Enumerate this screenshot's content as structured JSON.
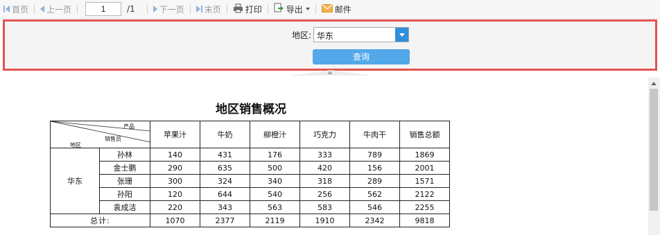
{
  "toolbar": {
    "first": "首页",
    "prev": "上一页",
    "page_value": "1",
    "page_total": "/1",
    "next": "下一页",
    "last": "末页",
    "print": "打印",
    "export": "导出",
    "mail": "邮件"
  },
  "params": {
    "region_label": "地区:",
    "region_value": "华东",
    "query_label": "查询"
  },
  "report": {
    "title": "地区销售概况",
    "corner": {
      "product": "产品",
      "salesperson": "销售员",
      "region": "地区"
    },
    "columns": [
      "苹果汁",
      "牛奶",
      "柳橙汁",
      "巧克力",
      "牛肉干",
      "销售总额"
    ],
    "region": "华东",
    "rows": [
      {
        "name": "孙林",
        "values": [
          "140",
          "431",
          "176",
          "333",
          "789",
          "1869"
        ]
      },
      {
        "name": "金士鹏",
        "values": [
          "290",
          "635",
          "500",
          "420",
          "156",
          "2001"
        ]
      },
      {
        "name": "张珊",
        "values": [
          "300",
          "324",
          "340",
          "318",
          "289",
          "1571"
        ]
      },
      {
        "name": "孙阳",
        "values": [
          "120",
          "644",
          "540",
          "256",
          "562",
          "2122"
        ]
      },
      {
        "name": "袁成洁",
        "values": [
          "220",
          "343",
          "563",
          "583",
          "546",
          "2255"
        ]
      }
    ],
    "total_label": "总计:",
    "totals": [
      "1070",
      "2377",
      "2119",
      "1910",
      "2342",
      "9818"
    ]
  },
  "colors": {
    "highlight_border": "#e45252",
    "query_button": "#52a8e8",
    "combo_button": "#2e8fdc"
  }
}
